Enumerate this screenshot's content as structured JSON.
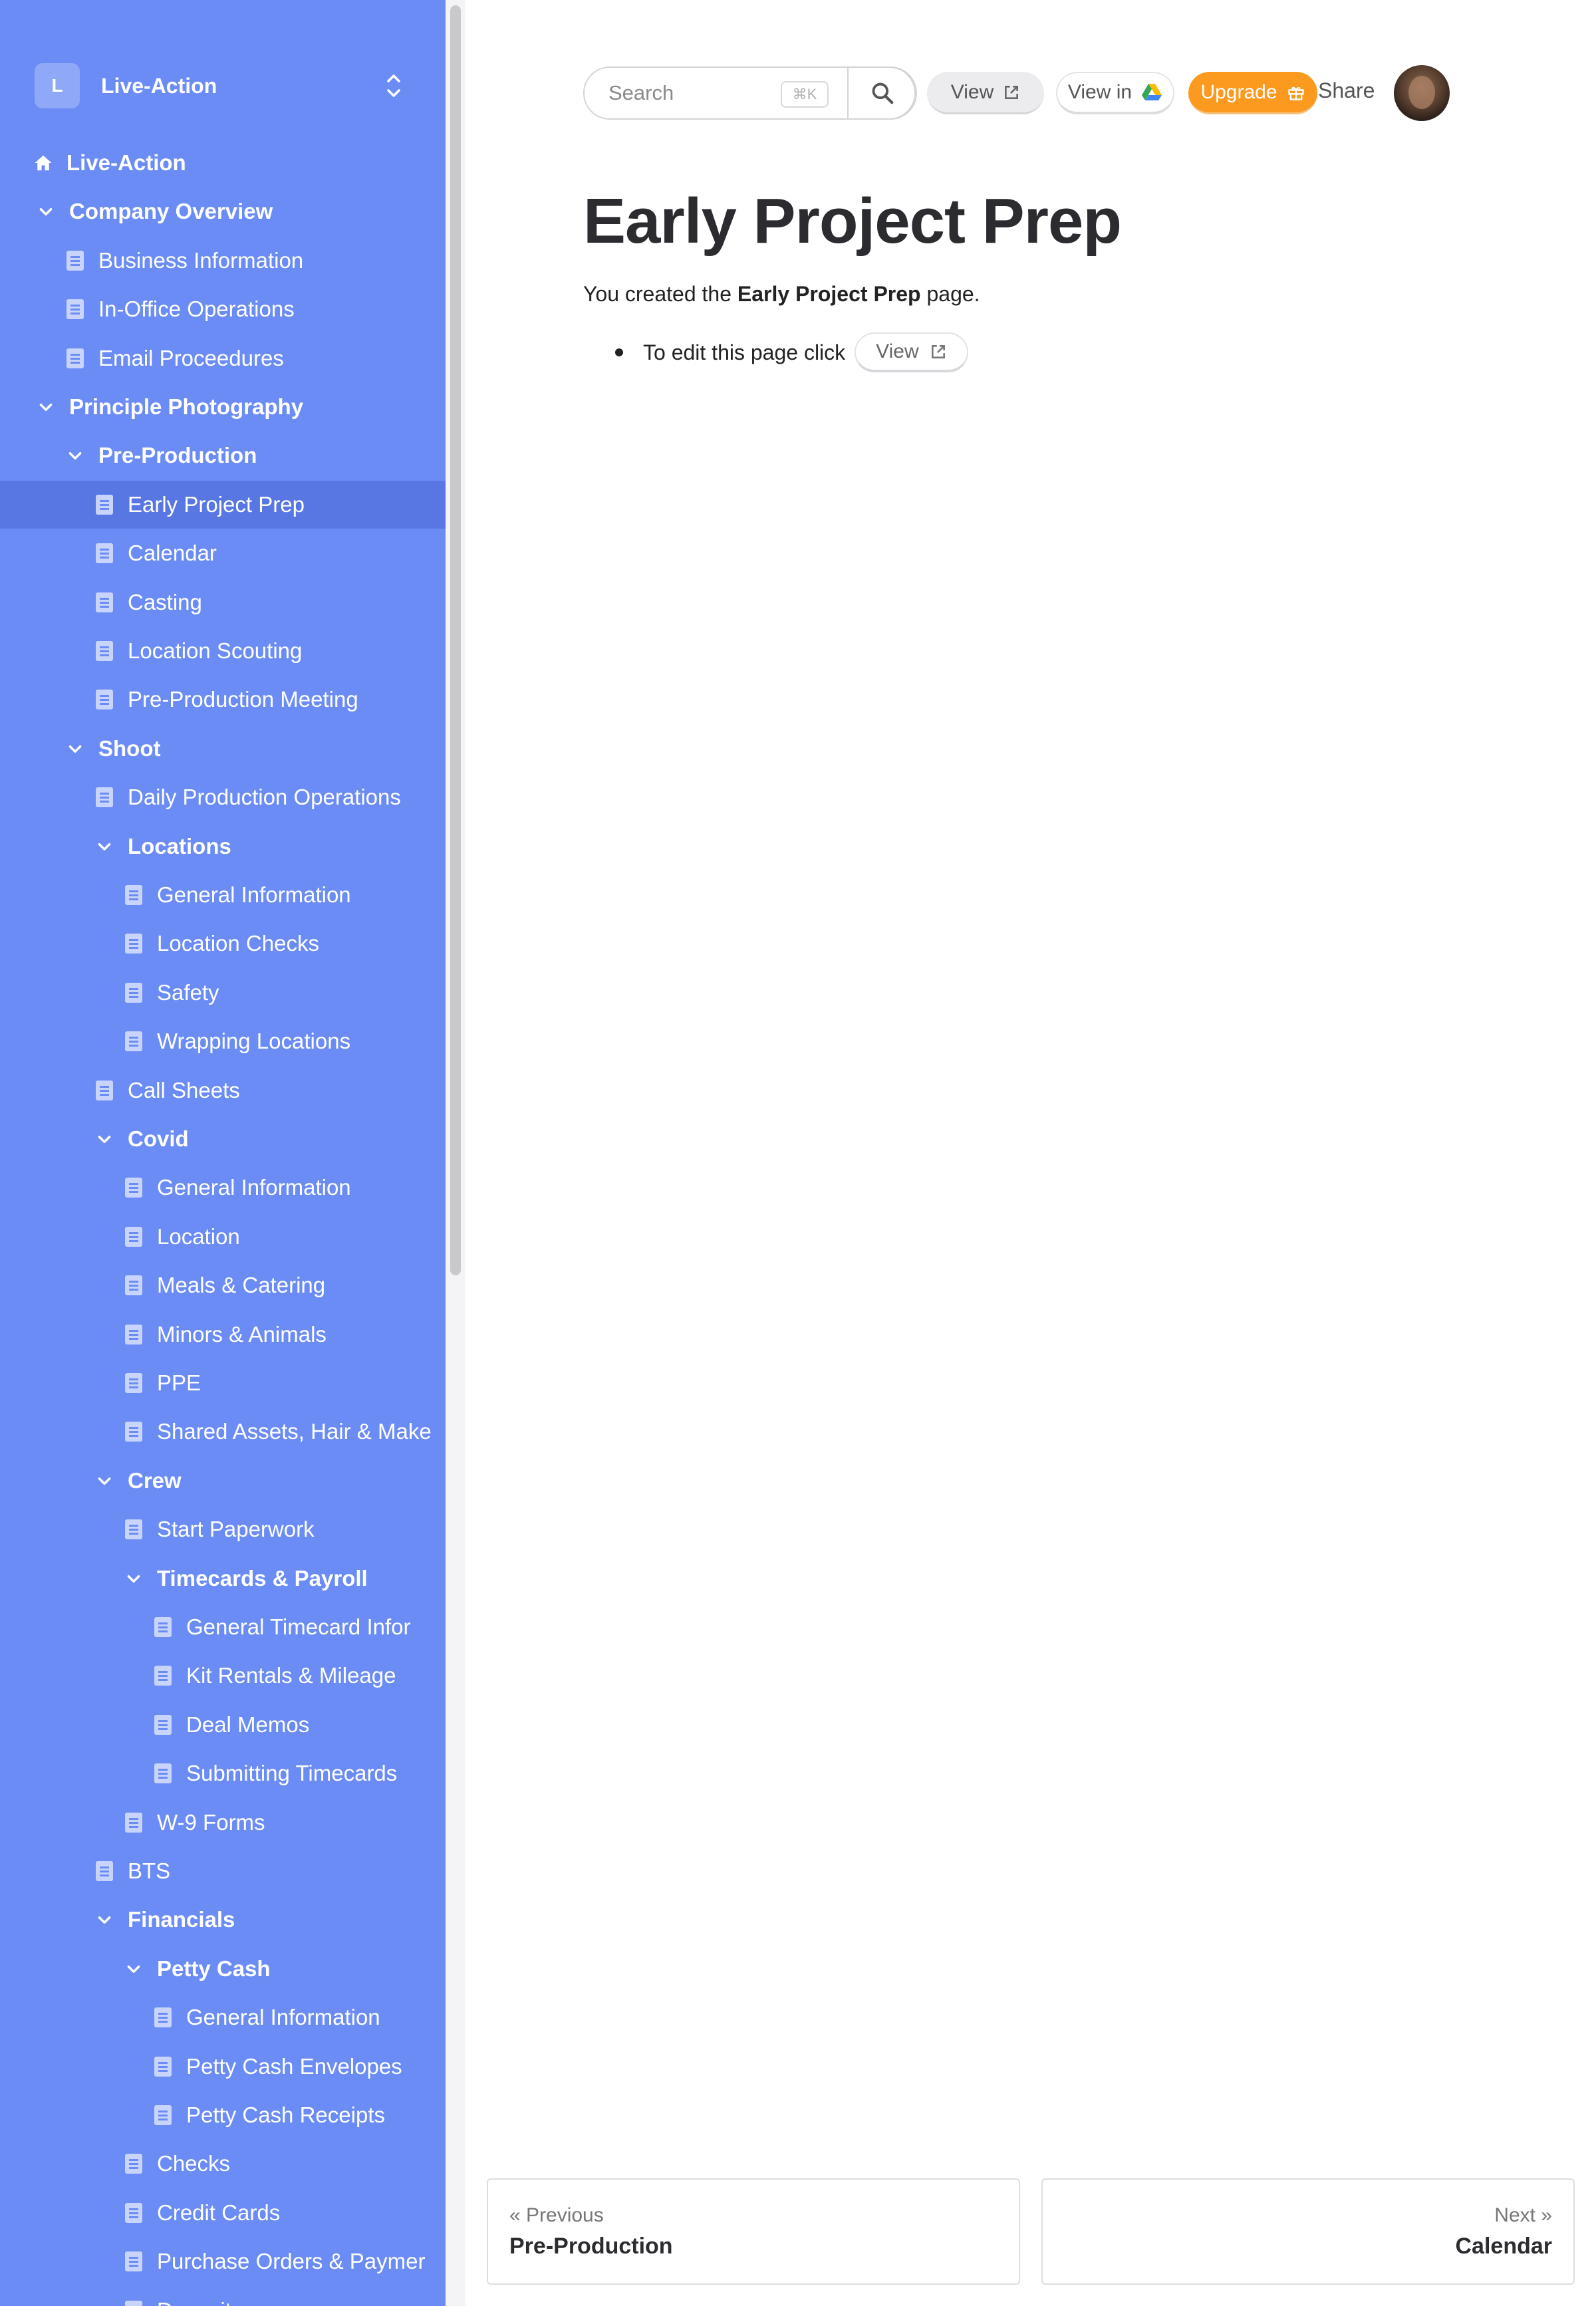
{
  "workspace": {
    "initial": "L",
    "name": "Live-Action"
  },
  "nav": [
    {
      "label": "Live-Action",
      "type": "home",
      "bold": true
    },
    {
      "label": "Company Overview",
      "type": "folder",
      "bold": true
    },
    {
      "label": "Business Information",
      "type": "page"
    },
    {
      "label": "In-Office Operations",
      "type": "page"
    },
    {
      "label": "Email Proceedures",
      "type": "page"
    },
    {
      "label": "Principle Photography",
      "type": "folder",
      "bold": true
    },
    {
      "label": "Pre-Production",
      "type": "folder",
      "bold": true
    },
    {
      "label": "Early Project Prep",
      "type": "page",
      "active": true
    },
    {
      "label": "Calendar",
      "type": "page"
    },
    {
      "label": "Casting",
      "type": "page"
    },
    {
      "label": "Location Scouting",
      "type": "page"
    },
    {
      "label": "Pre-Production Meeting",
      "type": "page"
    },
    {
      "label": "Shoot",
      "type": "folder",
      "bold": true
    },
    {
      "label": "Daily Production Operations",
      "type": "page"
    },
    {
      "label": "Locations",
      "type": "folder",
      "bold": true
    },
    {
      "label": "General Information",
      "type": "page"
    },
    {
      "label": "Location Checks",
      "type": "page"
    },
    {
      "label": "Safety",
      "type": "page"
    },
    {
      "label": "Wrapping Locations",
      "type": "page"
    },
    {
      "label": "Call Sheets",
      "type": "page"
    },
    {
      "label": "Covid",
      "type": "folder",
      "bold": true
    },
    {
      "label": "General Information",
      "type": "page"
    },
    {
      "label": "Location",
      "type": "page"
    },
    {
      "label": "Meals & Catering",
      "type": "page"
    },
    {
      "label": "Minors & Animals",
      "type": "page"
    },
    {
      "label": "PPE",
      "type": "page"
    },
    {
      "label": "Shared Assets, Hair & Make",
      "type": "page"
    },
    {
      "label": "Crew",
      "type": "folder",
      "bold": true
    },
    {
      "label": "Start Paperwork",
      "type": "page"
    },
    {
      "label": "Timecards & Payroll",
      "type": "folder",
      "bold": true
    },
    {
      "label": "General Timecard Infor",
      "type": "page"
    },
    {
      "label": "Kit Rentals & Mileage",
      "type": "page"
    },
    {
      "label": "Deal Memos",
      "type": "page"
    },
    {
      "label": "Submitting Timecards",
      "type": "page"
    },
    {
      "label": "W-9 Forms",
      "type": "page"
    },
    {
      "label": "BTS",
      "type": "page"
    },
    {
      "label": "Financials",
      "type": "folder",
      "bold": true
    },
    {
      "label": "Petty Cash",
      "type": "folder",
      "bold": true
    },
    {
      "label": "General Information",
      "type": "page"
    },
    {
      "label": "Petty Cash Envelopes",
      "type": "page"
    },
    {
      "label": "Petty Cash Receipts",
      "type": "page"
    },
    {
      "label": "Checks",
      "type": "page"
    },
    {
      "label": "Credit Cards",
      "type": "page"
    },
    {
      "label": "Purchase Orders & Paymer",
      "type": "page"
    },
    {
      "label": "Deposits",
      "type": "page"
    }
  ],
  "toolbar": {
    "search_placeholder": "Search",
    "shortcut": "⌘K",
    "view_label": "View",
    "view_in_label": "View in",
    "upgrade_label": "Upgrade",
    "share_label": "Share"
  },
  "page": {
    "title": "Early Project Prep",
    "intro_prefix": "You created the ",
    "intro_bold": "Early Project Prep",
    "intro_suffix": " page.",
    "bullet_text": "To edit this page click",
    "bullet_button": "View"
  },
  "pager": {
    "prev_small": "« Previous",
    "prev_title": "Pre-Production",
    "next_small": "Next »",
    "next_title": "Calendar"
  },
  "colors": {
    "sidebar_bg": "#6b8cf5",
    "sidebar_active": "#5877e3",
    "upgrade": "#fb9a1e"
  }
}
